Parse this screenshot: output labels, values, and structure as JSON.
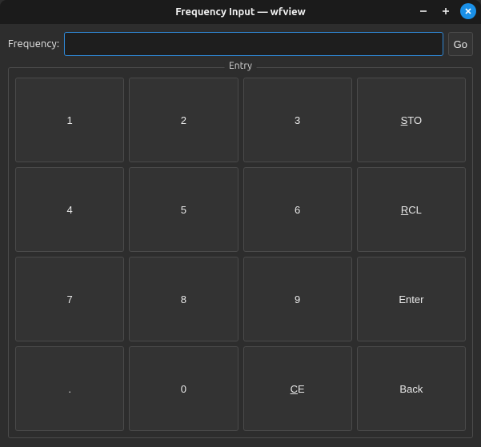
{
  "window": {
    "title": "Frequency Input — wfview"
  },
  "frequency": {
    "label": "Frequency:",
    "value": "",
    "placeholder": ""
  },
  "go_button": {
    "label": "Go"
  },
  "entry_group": {
    "legend": "Entry"
  },
  "keys": {
    "k1": "1",
    "k2": "2",
    "k3": "3",
    "sto_pre": "S",
    "sto_rest": "TO",
    "k4": "4",
    "k5": "5",
    "k6": "6",
    "rcl_pre": "R",
    "rcl_rest": "CL",
    "k7": "7",
    "k8": "8",
    "k9": "9",
    "enter": "Enter",
    "dot": ".",
    "k0": "0",
    "ce_pre": "C",
    "ce_rest": "E",
    "back": "Back"
  }
}
